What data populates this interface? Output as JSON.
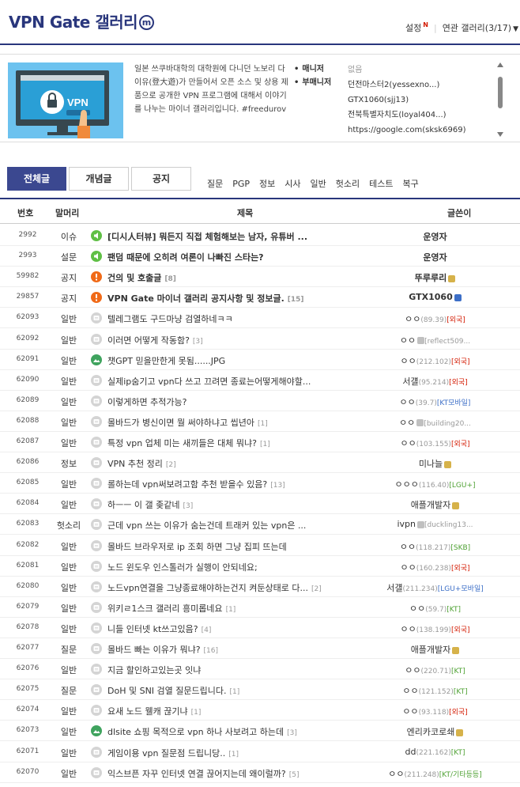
{
  "header": {
    "title": "VPN Gate 갤러리",
    "mini_badge": "m",
    "settings_label": "설정",
    "settings_new": "N",
    "related_label": "연관 갤러리(3/17)"
  },
  "info": {
    "thumb_text": "VPN",
    "description": "일본 쓰쿠바대학의 대학원에 다니던 노보리 다이유(登大遊)가 만들어서 오픈 소스 및 상용 제품으로 공개한 VPN 프로그램에 대해서 이야기를 나누는 마이너 갤러리입니다. #freedurov",
    "manager_label": "매니저",
    "submanager_label": "부매니저",
    "manager_value": "없음",
    "submanagers": [
      "던전마스터2(yessexno...)",
      "GTX1060(sjj13)",
      "전북특별자치도(loyal404...)",
      "https://google.com(sksk6969)"
    ]
  },
  "tabs": [
    "전체글",
    "개념글",
    "공지"
  ],
  "subtabs": [
    "질문",
    "PGP",
    "정보",
    "시사",
    "일반",
    "헛소리",
    "테스트",
    "복구"
  ],
  "table": {
    "headers": {
      "num": "번호",
      "cat": "말머리",
      "title": "제목",
      "writer": "글쓴이"
    },
    "rows": [
      {
        "num": "2992",
        "cat": "이슈",
        "icon": "speaker",
        "title": "[디시人터뷰] 뭐든지 직접 체험해보는 남자, 유튜버 ...",
        "bold": true,
        "writer": "운영자",
        "wbold": true
      },
      {
        "num": "2993",
        "cat": "설문",
        "icon": "speaker",
        "title": "팬덤 때문에 오히려 여론이 나빠진 스타는?",
        "bold": true,
        "writer": "운영자",
        "wbold": true
      },
      {
        "num": "59982",
        "cat": "공지",
        "icon": "notice",
        "title": "건의 및 호출글",
        "count": "[8]",
        "bold": true,
        "writer": "뚜루루리",
        "wbold": true,
        "lock": "y"
      },
      {
        "num": "29857",
        "cat": "공지",
        "icon": "notice",
        "title": "VPN Gate 마이너 갤러리 공지사항 및 정보글.",
        "count": "[15]",
        "bold": true,
        "writer": "GTX1060",
        "wbold": true,
        "lock": "b"
      },
      {
        "num": "62093",
        "cat": "일반",
        "icon": "text",
        "title": "텔레그램도 구드마냥 검열하네ㅋㅋ",
        "writer": "ㅇㅇ",
        "ip": "(89.39)",
        "isp": "[외국]",
        "ispc": "r"
      },
      {
        "num": "62092",
        "cat": "일반",
        "icon": "text",
        "title": "이러면 어떻게 작동함?",
        "count": "[3]",
        "writer": "ㅇㅇ",
        "fix": true,
        "ip": "[reflect509...",
        "isp": ""
      },
      {
        "num": "62091",
        "cat": "일반",
        "icon": "pic",
        "title": "챗GPT 믿을만한게 못됨......JPG",
        "writer": "ㅇㅇ",
        "ip": "(212.102)",
        "isp": "[외국]",
        "ispc": "r"
      },
      {
        "num": "62090",
        "cat": "일반",
        "icon": "text",
        "title": "실제ip숨기고 vpn다 쓰고 끄려면 종료는어떻게해야할...",
        "writer": "서걜",
        "ip": "(95.214)",
        "isp": "[외국]",
        "ispc": "r"
      },
      {
        "num": "62089",
        "cat": "일반",
        "icon": "text",
        "title": "이렇게하면 추적가능?",
        "writer": "ㅇㅇ",
        "ip": "(39.7)",
        "isp": "[KT모바일]",
        "ispc": "b"
      },
      {
        "num": "62088",
        "cat": "일반",
        "icon": "text",
        "title": "몰바드가 병신이면 뭘 써야하냐고 씹년아",
        "count": "[1]",
        "writer": "ㅇㅇ",
        "fix": true,
        "ip": "[building20...",
        "isp": ""
      },
      {
        "num": "62087",
        "cat": "일반",
        "icon": "text",
        "title": "특정 vpn 업체 미는 새끼들은 대체 뭐냐?",
        "count": "[1]",
        "writer": "ㅇㅇ",
        "ip": "(103.155)",
        "isp": "[외국]",
        "ispc": "r"
      },
      {
        "num": "62086",
        "cat": "정보",
        "icon": "text",
        "title": "VPN 추천 정리",
        "count": "[2]",
        "writer": "미나늘",
        "lock": "y"
      },
      {
        "num": "62085",
        "cat": "일반",
        "icon": "text",
        "title": "롤하는데 vpn써보려고함 추천 받을수 있음?",
        "count": "[13]",
        "writer": "ㅇㅇㅇ",
        "ip": "(116.40)",
        "isp": "[LGU+]",
        "ispc": "g"
      },
      {
        "num": "62084",
        "cat": "일반",
        "icon": "text",
        "title": "하ㅡㅡ 이 갤 좆같네",
        "count": "[3]",
        "writer": "애플개발자",
        "lock": "y"
      },
      {
        "num": "62083",
        "cat": "헛소리",
        "icon": "text",
        "title": "근데 vpn 쓰는 이유가 숨는건데 트래커 있는 vpn은 ...",
        "writer": "ivpn",
        "fix": true,
        "ip": "[duckling13...",
        "isp": ""
      },
      {
        "num": "62082",
        "cat": "일반",
        "icon": "text",
        "title": "몰바드 브라우저로 ip 조회 하면 그냥 집피 뜨는데",
        "writer": "ㅇㅇ",
        "ip": "(118.217)",
        "isp": "[SKB]",
        "ispc": "g"
      },
      {
        "num": "62081",
        "cat": "일반",
        "icon": "text",
        "title": "노드 윈도우 인스톨러가 실행이 안되네요;",
        "writer": "ㅇㅇ",
        "ip": "(160.238)",
        "isp": "[외국]",
        "ispc": "r"
      },
      {
        "num": "62080",
        "cat": "일반",
        "icon": "text",
        "title": "노드vpn연결을 그냥종료해야하는건지 켜둔상태로 다...",
        "count": "[2]",
        "writer": "서걜",
        "ip": "(211.234)",
        "isp": "[LGU+모바일]",
        "ispc": "b"
      },
      {
        "num": "62079",
        "cat": "일반",
        "icon": "text",
        "title": "위키ㄹ1스크 갤러리 흥미롭네요",
        "count": "[1]",
        "writer": "ㅇㅇ",
        "ip": "(59.7)",
        "isp": "[KT]",
        "ispc": "g"
      },
      {
        "num": "62078",
        "cat": "일반",
        "icon": "text",
        "title": "니들 인터넷 kt쓰고있음?",
        "count": "[4]",
        "writer": "ㅇㅇ",
        "ip": "(138.199)",
        "isp": "[외국]",
        "ispc": "r"
      },
      {
        "num": "62077",
        "cat": "질문",
        "icon": "text",
        "title": "몰바드 빠는 이유가 뭐냐?",
        "count": "[16]",
        "writer": "애플개발자",
        "lock": "y"
      },
      {
        "num": "62076",
        "cat": "일반",
        "icon": "text",
        "title": "지금 할인하고있는곳 잇냐",
        "writer": "ㅇㅇ",
        "ip": "(220.71)",
        "isp": "[KT]",
        "ispc": "g"
      },
      {
        "num": "62075",
        "cat": "질문",
        "icon": "text",
        "title": "DoH 및 SNI 검열 질문드립니다.",
        "count": "[1]",
        "writer": "ㅇㅇ",
        "ip": "(121.152)",
        "isp": "[KT]",
        "ispc": "g"
      },
      {
        "num": "62074",
        "cat": "일반",
        "icon": "text",
        "title": "요새 노드 웰캐 끊기냐",
        "count": "[1]",
        "writer": "ㅇㅇ",
        "ip": "(93.118)",
        "isp": "[외국]",
        "ispc": "r"
      },
      {
        "num": "62073",
        "cat": "일반",
        "icon": "pic",
        "title": "dlsite 쇼핑 목적으로 vpn 하나 사보려고 하는데",
        "count": "[3]",
        "writer": "엔리카코로쇄",
        "lock": "y"
      },
      {
        "num": "62071",
        "cat": "일반",
        "icon": "text",
        "title": "게임이용 vpn 질문점 드립니당..",
        "count": "[1]",
        "writer": "dd",
        "ip": "(221.162)",
        "isp": "[KT]",
        "ispc": "g"
      },
      {
        "num": "62070",
        "cat": "일반",
        "icon": "text",
        "title": "익스브픈 자꾸 인터넷 연결 끊어지는데 왜이럴까?",
        "count": "[5]",
        "writer": "ㅇㅇ",
        "ip": "(211.248)",
        "isp": "[KT/기타등등]",
        "ispc": "g"
      }
    ]
  }
}
